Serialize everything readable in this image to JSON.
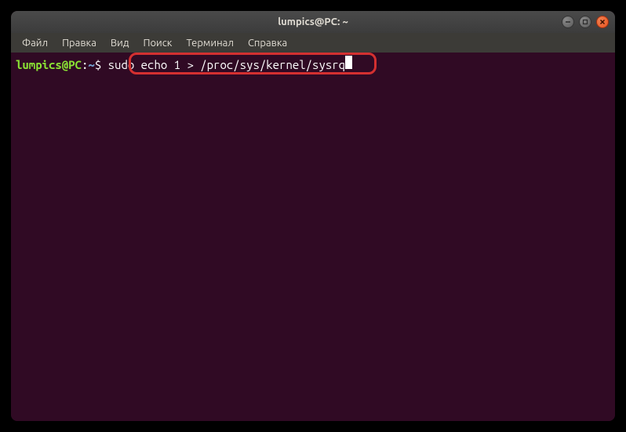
{
  "window": {
    "title": "lumpics@PC: ~"
  },
  "menubar": {
    "items": [
      {
        "label": "Файл"
      },
      {
        "label": "Правка"
      },
      {
        "label": "Вид"
      },
      {
        "label": "Поиск"
      },
      {
        "label": "Терминал"
      },
      {
        "label": "Справка"
      }
    ]
  },
  "terminal": {
    "prompt_user": "lumpics@PC",
    "prompt_colon": ":",
    "prompt_path": "~",
    "prompt_dollar": "$ ",
    "command": "sudo echo 1 > /proc/sys/kernel/sysrq"
  }
}
